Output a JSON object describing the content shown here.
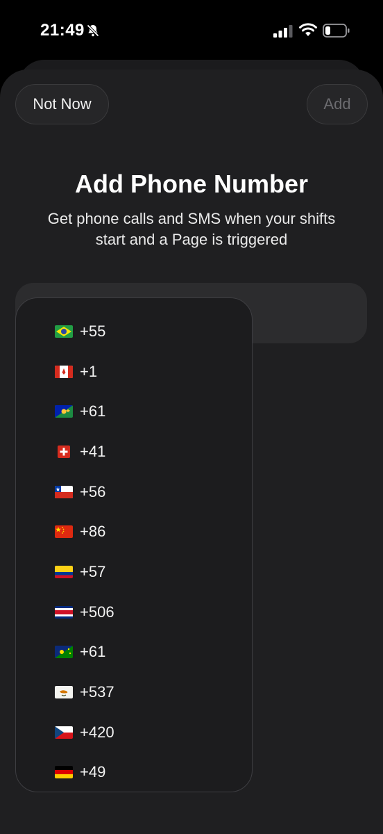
{
  "status": {
    "time": "21:49",
    "icons": [
      "bell-slash-icon",
      "cellular-signal-icon",
      "wifi-icon",
      "battery-icon"
    ]
  },
  "header": {
    "not_now_label": "Not Now",
    "add_label": "Add"
  },
  "content": {
    "title": "Add Phone Number",
    "subtitle": "Get phone calls and SMS when your shifts start and a Page is triggered"
  },
  "country_codes": [
    {
      "code": "+55",
      "flag": "brazil-flag-icon"
    },
    {
      "code": "+1",
      "flag": "canada-flag-icon"
    },
    {
      "code": "+61",
      "flag": "christmas-island-flag-icon"
    },
    {
      "code": "+41",
      "flag": "switzerland-flag-icon"
    },
    {
      "code": "+56",
      "flag": "chile-flag-icon"
    },
    {
      "code": "+86",
      "flag": "china-flag-icon"
    },
    {
      "code": "+57",
      "flag": "colombia-flag-icon"
    },
    {
      "code": "+506",
      "flag": "costa-rica-flag-icon"
    },
    {
      "code": "+61",
      "flag": "cocos-islands-flag-icon"
    },
    {
      "code": "+537",
      "flag": "cyprus-flag-icon"
    },
    {
      "code": "+420",
      "flag": "czechia-flag-icon"
    },
    {
      "code": "+49",
      "flag": "germany-flag-icon"
    }
  ],
  "colors": {
    "sheet": "#1f1f21",
    "field": "#2c2c2e",
    "dropdown": "#1c1c1e",
    "disabled_text": "#6c6c70"
  }
}
